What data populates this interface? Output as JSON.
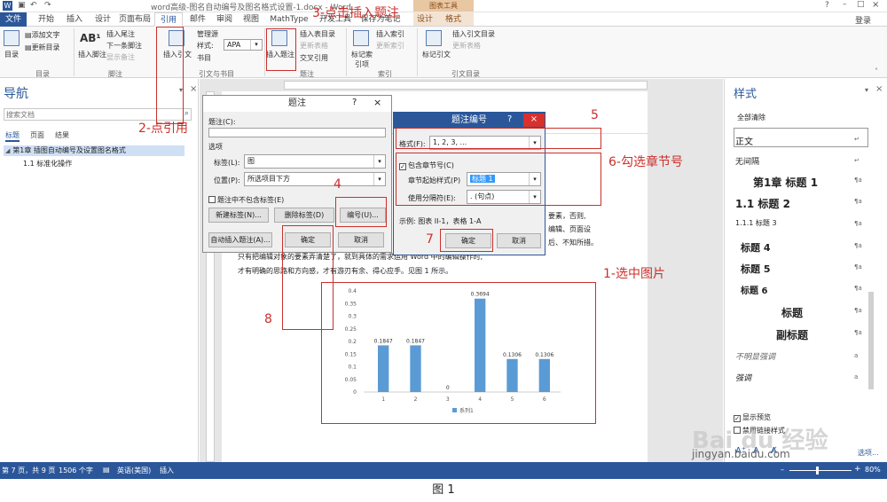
{
  "window": {
    "title": "word高级-图名自动编号及图名格式设置-1.docx - Word",
    "context_tab_group": "图表工具",
    "signin": "登录"
  },
  "tabs": [
    "文件",
    "开始",
    "插入",
    "设计",
    "页面布局",
    "引用",
    "邮件",
    "审阅",
    "视图",
    "MathType",
    "开发工具",
    "保存为笔记",
    "设计",
    "格式"
  ],
  "ribbon": {
    "toc": {
      "label": "目录",
      "add_text": "添加文字",
      "update_toc": "更新目录",
      "group": "目录"
    },
    "footnote": {
      "insert_footnote": "插入脚注",
      "insert_endnote": "插入尾注",
      "next_footnote": "下一条脚注",
      "show_notes": "显示备注",
      "group": "脚注",
      "ab_label": "AB¹"
    },
    "citation": {
      "insert_citation": "插入引文",
      "manage_source": "管理源",
      "style_label": "样式:",
      "style_value": "APA",
      "bibliography": "书目",
      "group": "引文与书目"
    },
    "caption": {
      "insert_caption": "插入题注",
      "insert_table_of_figures": "插入表目录",
      "update_table": "更新表格",
      "cross_reference": "交叉引用",
      "group": "题注"
    },
    "index": {
      "mark_entry": "标记索引项",
      "insert_index": "插入索引",
      "update_index": "更新索引",
      "group": "索引"
    },
    "toa": {
      "mark_citation": "标记引文",
      "insert_toa": "插入引文目录",
      "update_toa": "更新表格",
      "group": "引文目录"
    }
  },
  "nav": {
    "title": "导航",
    "search_placeholder": "搜索文档",
    "tabs": [
      "标题",
      "页面",
      "结果"
    ],
    "items": [
      "第1章 插图自动编号及设置图名格式",
      "1.1 标准化操作"
    ]
  },
  "document": {
    "text_lines": [
      "要素，否则,",
      "编辑、页面设",
      "后、不知所措。",
      "只有把编辑对象的要素弄清楚了，就到具体的需求运用 Word 中的编辑操作时,",
      "才有明确的思路和方向感，才有游刃有余、得心应手。见图 1 所示。"
    ]
  },
  "chart_data": {
    "type": "bar",
    "categories": [
      "1",
      "2",
      "3",
      "4",
      "5",
      "6"
    ],
    "values": [
      0.1847,
      0.1847,
      0,
      0.3694,
      0.1306,
      0.1306
    ],
    "data_labels": [
      "0.1847",
      "0.1847",
      "0",
      "0.3694",
      "0.1306",
      "0.1306"
    ],
    "y_ticks": [
      "0",
      "0.05",
      "0.1",
      "0.15",
      "0.2",
      "0.25",
      "0.3",
      "0.35",
      "0.4"
    ],
    "ylim": [
      0,
      0.4
    ],
    "series": [
      {
        "name": "系列1",
        "values": [
          0.1847,
          0.1847,
          0,
          0.3694,
          0.1306,
          0.1306
        ]
      }
    ],
    "legend": "bottom",
    "grid": false,
    "bar_color": "#5b9bd5"
  },
  "caption_dialog": {
    "title": "题注",
    "help": "?",
    "caption_label": "题注(C):",
    "caption_value": "",
    "options_label": "选项",
    "label_label": "标签(L):",
    "label_value": "图",
    "position_label": "位置(P):",
    "position_value": "所选项目下方",
    "exclude_label": "题注中不包含标签(E)",
    "new_label_btn": "新建标签(N)...",
    "delete_label_btn": "删除标签(D)",
    "numbering_btn": "编号(U)...",
    "autocaption_btn": "自动插入题注(A)...",
    "ok_btn": "确定",
    "cancel_btn": "取消"
  },
  "numbering_dialog": {
    "title": "题注编号",
    "help": "?",
    "format_label": "格式(F):",
    "format_value": "1, 2, 3, ...",
    "include_chapter_label": "包含章节号(C)",
    "chapter_style_label": "章节起始样式(P)",
    "chapter_style_value": "标题 1",
    "separator_label": "使用分隔符(E):",
    "separator_value": ".   (句点)",
    "example_text": "示例:  图表 II-1，表格 1-A",
    "ok_btn": "确定",
    "cancel_btn": "取消"
  },
  "styles_pane": {
    "title": "样式",
    "clear_all": "全部清除",
    "items": [
      "正文",
      "无间隔",
      "第1章  标题 1",
      "1.1  标题 2",
      "1.1.1  标题 3",
      "标题 4",
      "标题 5",
      "标题 6",
      "标题",
      "副标题",
      "不明显强调",
      "强调"
    ],
    "marks": [
      "↵",
      "↵",
      "¶a",
      "¶a",
      "¶a",
      "¶a",
      "¶a",
      "¶a",
      "¶a",
      "¶a",
      "a",
      "a"
    ],
    "show_preview": "显示预览",
    "disable_linked": "禁用链接样式",
    "options_link": "选项..."
  },
  "statusbar": {
    "page": "第 7 页，共 9 页",
    "words": "1506 个字",
    "language": "英语(美国)",
    "insert_mode": "插入",
    "zoom": "80%"
  },
  "annotations": {
    "step1": "1-选中图片",
    "step2": "2-点引用",
    "step3": "3-点击插入题注",
    "step4": "4",
    "step5": "5",
    "step6": "6-勾选章节号",
    "step7": "7",
    "step8": "8"
  },
  "watermark": {
    "brand": "Bai du 经验",
    "url": "jingyan.baidu.com"
  },
  "figure_caption": "图  1",
  "colors": {
    "accent": "#2b579a",
    "annotation": "#c9302c",
    "dialog_title": "#2b579a",
    "bar": "#5b9bd5"
  }
}
